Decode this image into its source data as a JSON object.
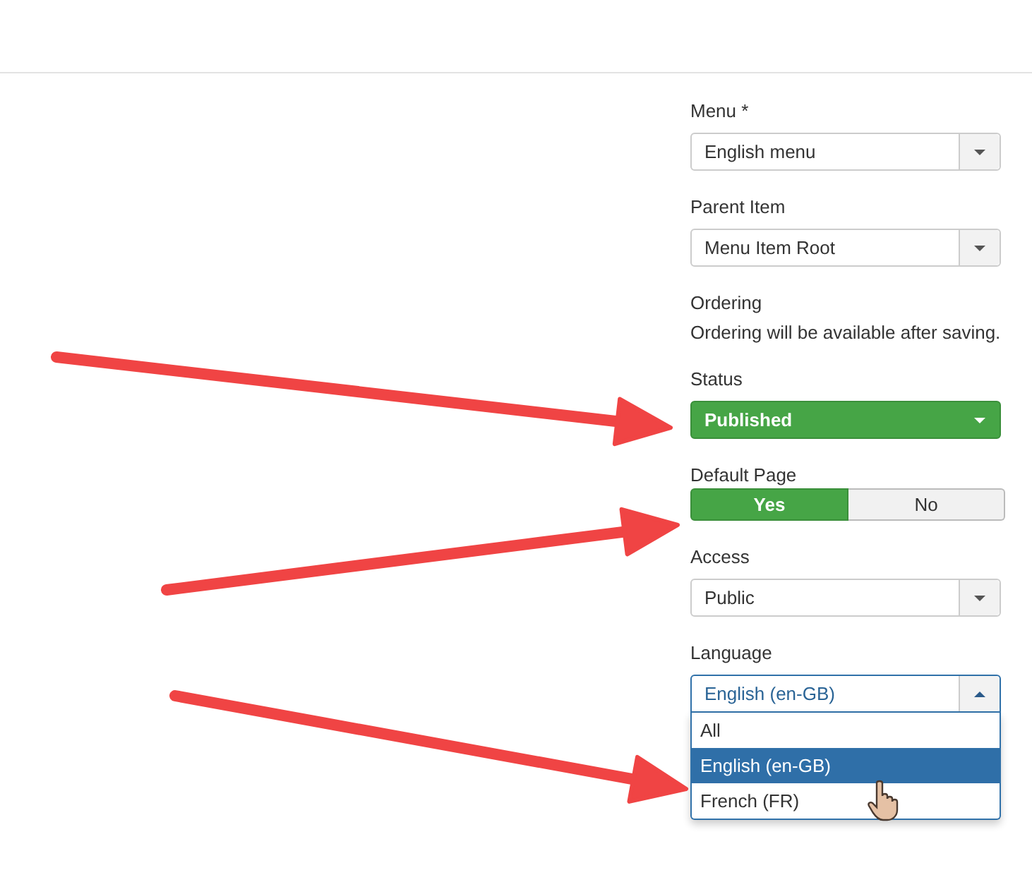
{
  "fields": [
    {
      "kind": "select",
      "label": "Menu *",
      "value": "English menu",
      "expanded": false
    },
    {
      "kind": "select",
      "label": "Parent Item",
      "value": "Menu Item Root",
      "expanded": false
    },
    {
      "kind": "note",
      "label": "Ordering",
      "text": "Ordering will be available after saving."
    },
    {
      "kind": "status",
      "label": "Status",
      "value": "Published"
    },
    {
      "kind": "toggle",
      "label": "Default Page",
      "options": [
        {
          "label": "Yes",
          "selected": true
        },
        {
          "label": "No",
          "selected": false
        }
      ]
    },
    {
      "kind": "select",
      "label": "Access",
      "value": "Public",
      "expanded": false
    },
    {
      "kind": "select",
      "label": "Language",
      "value": "English (en-GB)",
      "expanded": true,
      "options": [
        {
          "label": "All",
          "selected": false
        },
        {
          "label": "English (en-GB)",
          "selected": true
        },
        {
          "label": "French (FR)",
          "selected": false
        }
      ]
    }
  ]
}
